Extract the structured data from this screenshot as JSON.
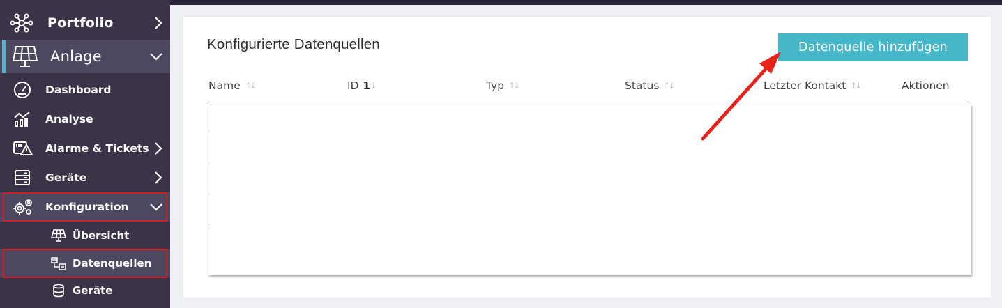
{
  "sidebar": {
    "portfolio": "Portfolio",
    "anlage": "Anlage",
    "dashboard": "Dashboard",
    "analyse": "Analyse",
    "alarme": "Alarme & Tickets",
    "geraete": "Geräte",
    "konfiguration": "Konfiguration",
    "sub_uebersicht": "Übersicht",
    "sub_datenquellen": "Datenquellen",
    "sub_geraete": "Geräte"
  },
  "main": {
    "title": "Konfigurierte Datenquellen",
    "add_button": "Datenquelle hinzufügen",
    "columns": {
      "name": "Name",
      "id": "ID",
      "id_sort_order": "1",
      "typ": "Typ",
      "status": "Status",
      "letzter_kontakt": "Letzter Kontakt",
      "aktionen": "Aktionen"
    },
    "rows": []
  },
  "colors": {
    "sidebar_bg": "#3b3449",
    "active_bg": "#4e4760",
    "accent": "#45b7c9",
    "highlight": "#d11f27"
  }
}
